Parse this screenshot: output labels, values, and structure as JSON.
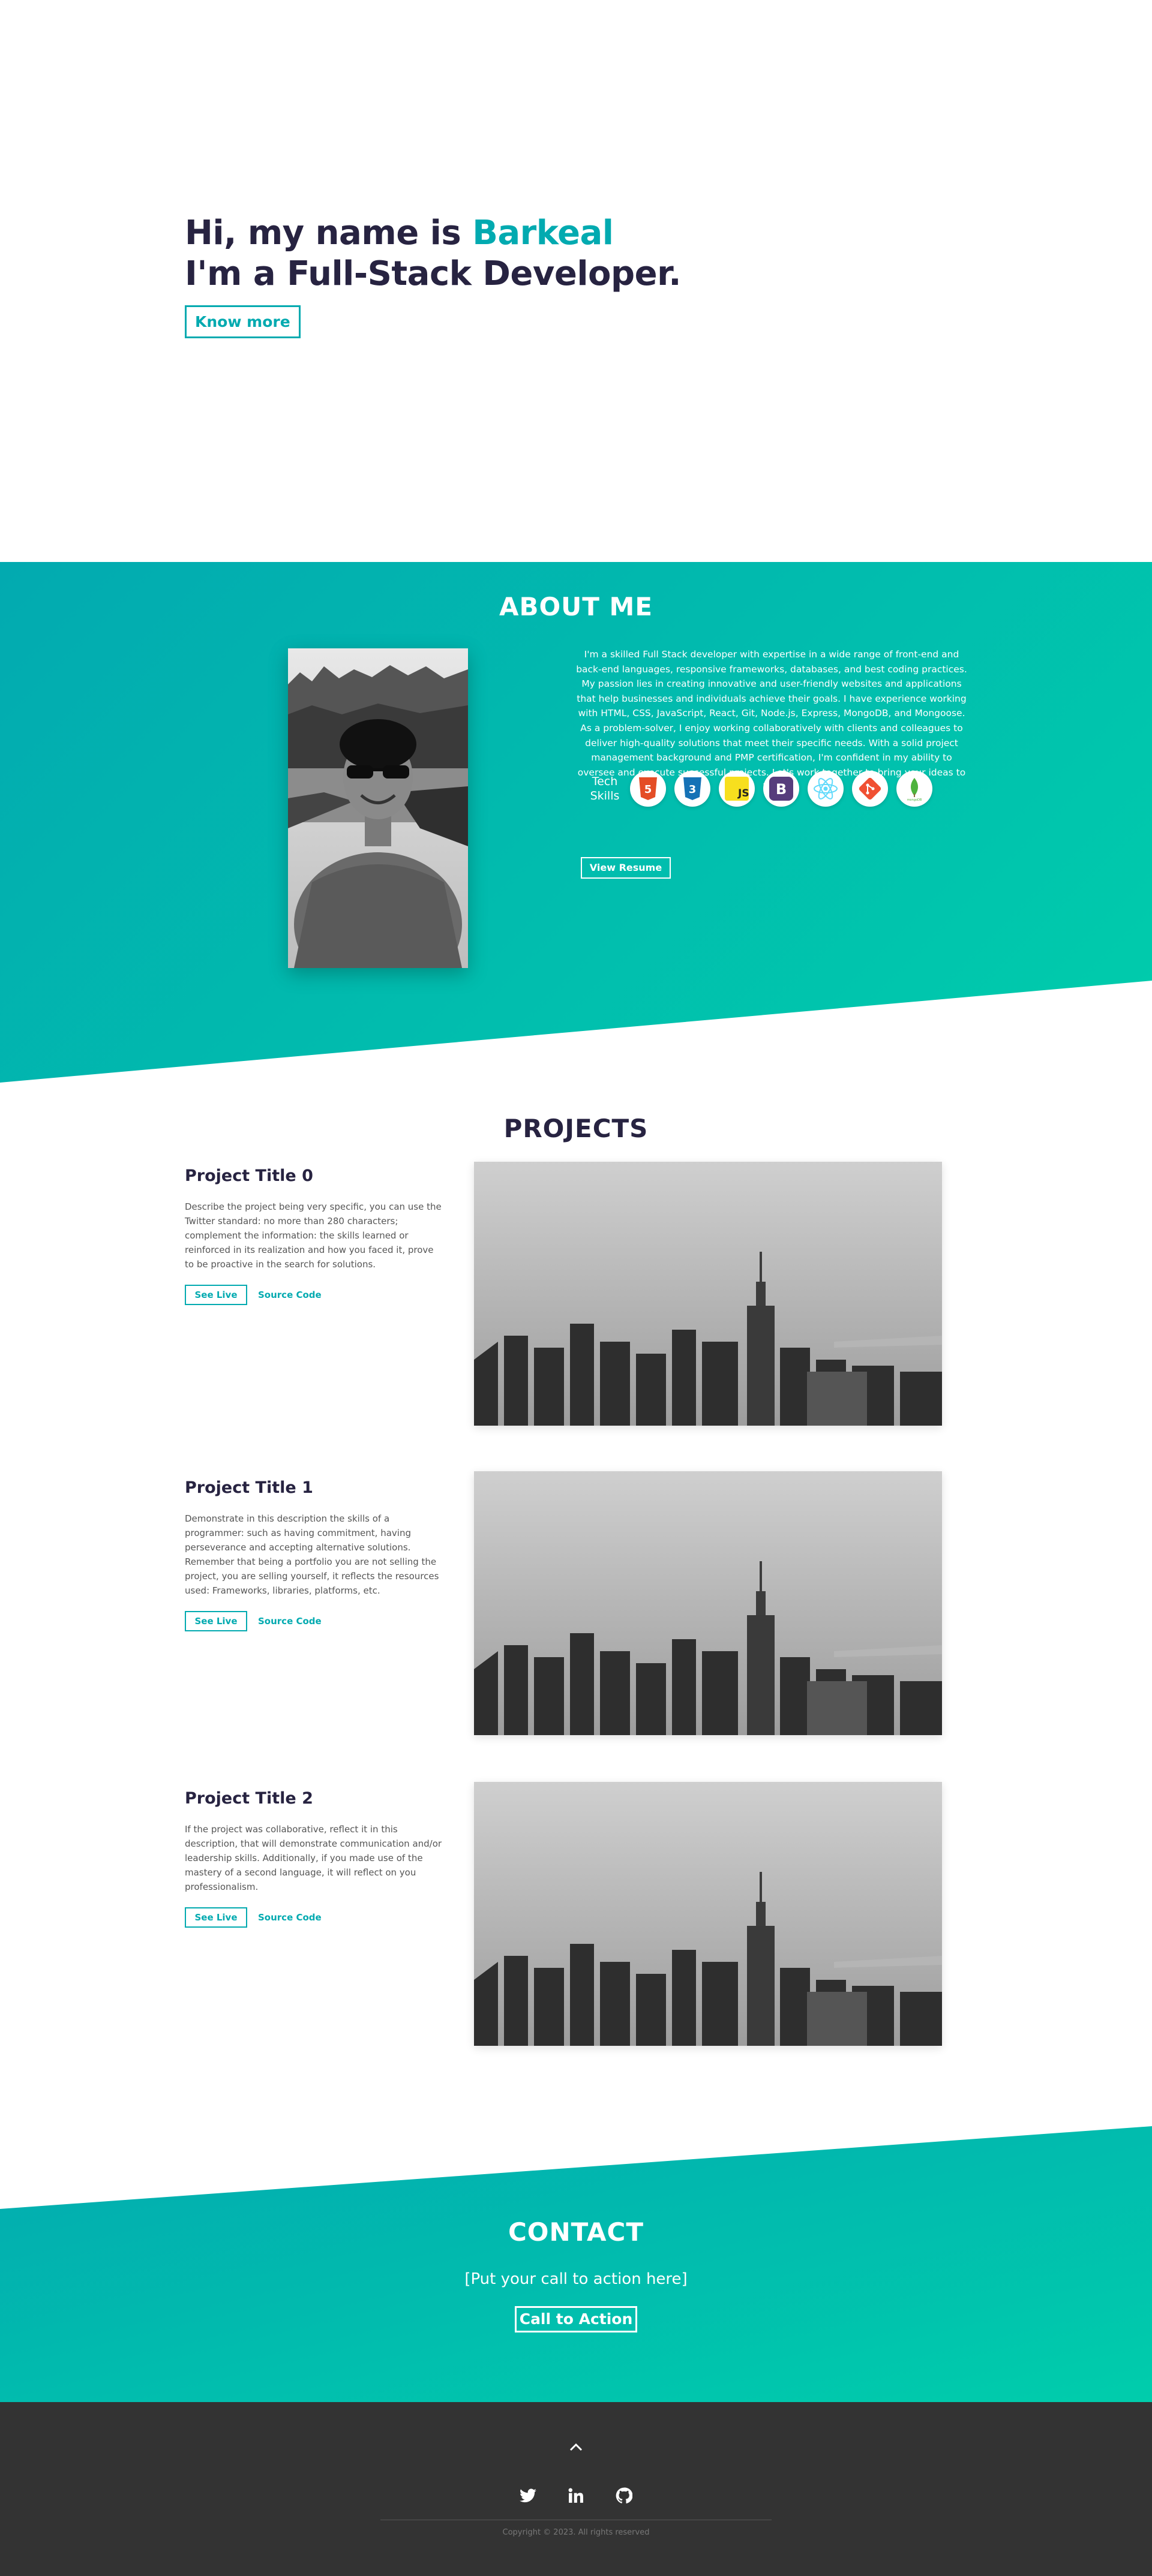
{
  "hero": {
    "greeting": "Hi, my name is ",
    "name": "Barkeal",
    "subtitle": "I'm a Full-Stack Developer.",
    "cta_label": "Know more"
  },
  "about": {
    "title": "ABOUT ME",
    "text": "I'm a skilled Full Stack developer with expertise in a wide range of front-end and back-end languages, responsive frameworks, databases, and best coding practices. My passion lies in creating innovative and user-friendly websites and applications that help businesses and individuals achieve their goals. I have experience working with HTML, CSS, JavaScript, React, Git, Node.js, Express, MongoDB, and Mongoose. As a problem-solver, I enjoy working collaboratively with clients and colleagues to deliver high-quality solutions that meet their specific needs. With a solid project management background and PMP certification, I'm confident in my ability to oversee and execute successful projects. Let's work together to bring your ideas to life!",
    "skills_label": "Tech Skills",
    "skills": [
      {
        "icon": "html5-icon",
        "color": "#e44d26"
      },
      {
        "icon": "css3-icon",
        "color": "#1572b6"
      },
      {
        "icon": "javascript-icon",
        "color": "#f7df1e",
        "label": "JS"
      },
      {
        "icon": "bootstrap-icon",
        "color": "#563d7c",
        "label": "B"
      },
      {
        "icon": "react-icon",
        "color": "#61dafb"
      },
      {
        "icon": "git-icon",
        "color": "#f05033"
      },
      {
        "icon": "mongodb-icon",
        "color": "#4db33d",
        "label": "mongoDB"
      }
    ],
    "resume_label": "View Resume"
  },
  "projects": {
    "title": "PROJECTS",
    "items": [
      {
        "title": "Project Title 0",
        "description": "Describe the project being very specific, you can use the Twitter standard: no more than 280 characters; complement the information: the skills learned or reinforced in its realization and how you faced it, prove to be proactive in the search for solutions.",
        "live_label": "See Live",
        "source_label": "Source Code"
      },
      {
        "title": "Project Title 1",
        "description": "Demonstrate in this description the skills of a programmer: such as having commitment, having perseverance and accepting alternative solutions. Remember that being a portfolio you are not selling the project, you are selling yourself, it reflects the resources used: Frameworks, libraries, platforms, etc.",
        "live_label": "See Live",
        "source_label": "Source Code"
      },
      {
        "title": "Project Title 2",
        "description": "If the project was collaborative, reflect it in this description, that will demonstrate communication and/or leadership skills. Additionally, if you made use of the mastery of a second language, it will reflect on you professionalism.",
        "live_label": "See Live",
        "source_label": "Source Code"
      }
    ]
  },
  "contact": {
    "title": "CONTACT",
    "cta_text": "[Put your call to action here]",
    "button_label": "Call to Action"
  },
  "footer": {
    "socials": [
      "twitter-icon",
      "linkedin-icon",
      "github-icon"
    ],
    "copyright": "Copyright © 2023. All rights reserved"
  },
  "colors": {
    "primary": "#02aab0",
    "secondary": "#00cdac",
    "dark": "#272341",
    "footer": "#333333"
  }
}
